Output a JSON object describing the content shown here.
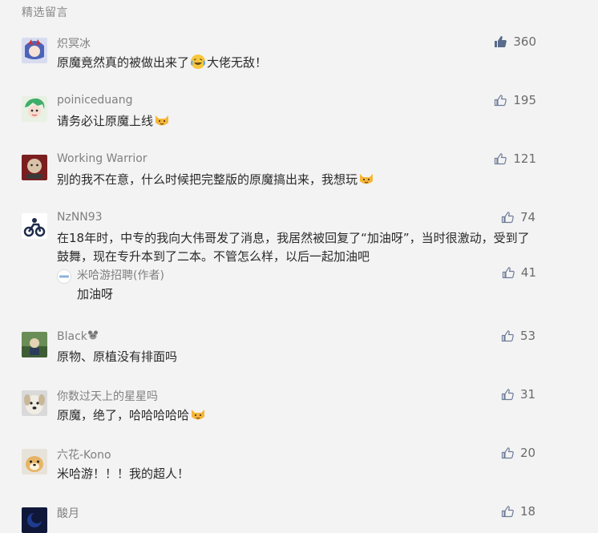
{
  "header": {
    "title": "精选留言"
  },
  "colors": {
    "like_filled": "#5a6c8c",
    "like_outline": "#6f7d99",
    "text": "#2a2a2a",
    "meta": "#808080"
  },
  "comments": [
    {
      "name": "炽冥冰",
      "pre": "原魔竟然真的被做出来了",
      "emoji": "laughing-tears-emoji",
      "post": "大佬无敌！",
      "likes": "360",
      "liked": true
    },
    {
      "name": "poiniceduang",
      "pre": "请务必让原魔上线",
      "emoji": "cat-emoji",
      "post": "",
      "likes": "195"
    },
    {
      "name": "Working Warrior",
      "pre": "别的我不在意，什么时候把完整版的原魔搞出来，我想玩",
      "emoji": "cat-emoji",
      "post": "",
      "likes": "121"
    },
    {
      "name": "NzNN93",
      "pre": "在18年时，中专的我向大伟哥发了消息，我居然被回复了“加油呀”，当时很激动，受到了鼓舞，现在专升本到了二本。不管怎么样，以后一起加油吧",
      "post": "",
      "likes": "74",
      "reply": {
        "name": "米哈游招聘(作者)",
        "content": "加油呀",
        "likes": "41"
      }
    },
    {
      "name": "Black",
      "pre": "原物、原植没有排面吗",
      "post": "",
      "likes": "53"
    },
    {
      "name": "你数过天上的星星吗",
      "pre": "原魔，绝了，哈哈哈哈哈",
      "emoji": "cat-emoji",
      "post": "",
      "likes": "31"
    },
    {
      "name": "六花-Kono",
      "pre": "米哈游！！！我的超人！",
      "post": "",
      "likes": "20"
    },
    {
      "name": "酸月",
      "pre": "",
      "post": "",
      "likes": "18"
    }
  ]
}
